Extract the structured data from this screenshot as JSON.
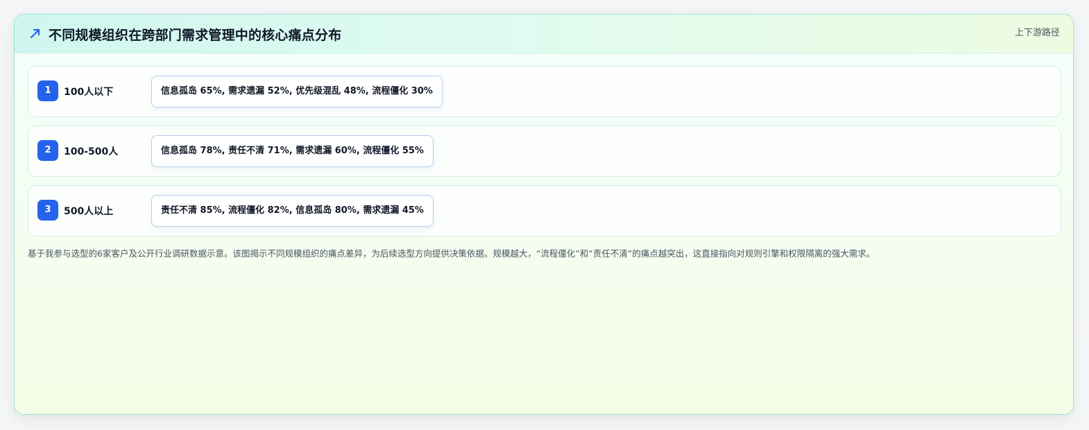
{
  "card": {
    "title": "不同规模组织在跨部门需求管理中的核心痛点分布",
    "corner_link": "上下游路径",
    "icon": "trending-up-icon",
    "accent_color": "#2563eb"
  },
  "rows": [
    {
      "index": "1",
      "size": "100人以下",
      "pain_points": "信息孤岛 65%, 需求遗漏 52%, 优先级混乱 48%, 流程僵化 30%"
    },
    {
      "index": "2",
      "size": "100-500人",
      "pain_points": "信息孤岛 78%, 责任不清 71%, 需求遗漏 60%, 流程僵化 55%"
    },
    {
      "index": "3",
      "size": "500人以上",
      "pain_points": "责任不清 85%, 流程僵化 82%, 信息孤岛 80%, 需求遗漏 45%"
    }
  ],
  "footnote": "基于我参与选型的6家客户及公开行业调研数据示意。该图揭示不同规模组织的痛点差异，为后续选型方向提供决策依据。规模越大，“流程僵化”和“责任不清”的痛点越突出，这直接指向对规则引擎和权限隔离的强大需求。"
}
